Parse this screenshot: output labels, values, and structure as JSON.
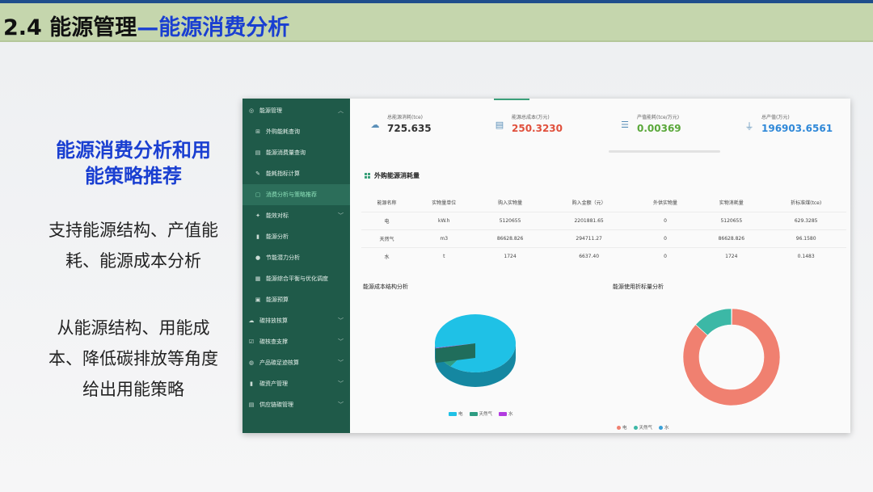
{
  "slide": {
    "title_main": "2.4 能源管理",
    "title_accent": "—能源消费分析",
    "heading_line1": "能源消费分析和用",
    "heading_line2": "能策略推荐",
    "para1_line1": "支持能源结构、产值能",
    "para1_line2": "耗、能源成本分析",
    "para2_line1": "从能源结构、用能成",
    "para2_line2": "本、降低碳排放等角度",
    "para2_line3": "给出用能策略"
  },
  "sidebar": {
    "items": [
      {
        "label": "能源管理",
        "icon": "gear-icon"
      },
      {
        "label": "外购能耗查询",
        "icon": "grid-icon"
      },
      {
        "label": "能源消费量查询",
        "icon": "calendar-icon"
      },
      {
        "label": "能耗指标计算",
        "icon": "edit-icon"
      },
      {
        "label": "消费分析与策略推荐",
        "icon": "doc-icon"
      },
      {
        "label": "能效对标",
        "icon": "bookmark-icon"
      },
      {
        "label": "能源分析",
        "icon": "bar-chart-icon"
      },
      {
        "label": "节能潜力分析",
        "icon": "circle-icon"
      },
      {
        "label": "能源综合平衡与优化调度",
        "icon": "balance-icon"
      },
      {
        "label": "能源预算",
        "icon": "file-icon"
      },
      {
        "label": "碳排放核算",
        "icon": "cloud-icon"
      },
      {
        "label": "碳核查支撑",
        "icon": "check-icon"
      },
      {
        "label": "产品碳足迹核算",
        "icon": "globe-icon"
      },
      {
        "label": "碳资产管理",
        "icon": "bar-chart-icon"
      },
      {
        "label": "供应链碳管理",
        "icon": "list-icon"
      }
    ]
  },
  "stats": [
    {
      "label": "总能源消耗(tce)",
      "value": "725.635",
      "color": "#333333",
      "icon": "cloud-upload-icon"
    },
    {
      "label": "能源总成本(万元)",
      "value": "250.3230",
      "color": "#e0503c",
      "icon": "money-icon"
    },
    {
      "label": "产值能耗(tce/万元)",
      "value": "0.00369",
      "color": "#5aa83a",
      "icon": "list-icon"
    },
    {
      "label": "总产值(万元)",
      "value": "196903.6561",
      "color": "#2f88d8",
      "icon": "bell-icon"
    }
  ],
  "table": {
    "title": "外购能源消耗量",
    "headers": [
      "能源名称",
      "实物量单位",
      "购入实物量",
      "购入金额（元）",
      "外供实物量",
      "实物消耗量",
      "折标准煤(tce)"
    ],
    "rows": [
      [
        "电",
        "kW.h",
        "5120655",
        "2201881.65",
        "0",
        "5120655",
        "629.3285"
      ],
      [
        "天然气",
        "m3",
        "86628.826",
        "294711.27",
        "0",
        "86628.826",
        "96.1580"
      ],
      [
        "水",
        "t",
        "1724",
        "6637.40",
        "0",
        "1724",
        "0.1483"
      ]
    ]
  },
  "charts": {
    "pie_title": "能源成本结构分析",
    "donut_title": "能源使用折标量分析",
    "legend": [
      "电",
      "天然气",
      "水"
    ]
  },
  "colors": {
    "sidebar": "#1f5a49",
    "electric": "#1fc1e6",
    "gas": "#2e9c82",
    "water": "#b23be0",
    "donut_main": "#f08070",
    "donut_gas": "#3cb8a6",
    "accent_blue": "#1a3fd1"
  },
  "chart_data": [
    {
      "type": "pie",
      "title": "能源成本结构分析",
      "categories": [
        "电",
        "天然气",
        "水"
      ],
      "values": [
        2201881.65,
        294711.27,
        6637.4
      ]
    },
    {
      "type": "pie",
      "title": "能源使用折标量分析",
      "categories": [
        "电",
        "天然气",
        "水"
      ],
      "values": [
        629.3285,
        96.158,
        0.1483
      ]
    }
  ]
}
